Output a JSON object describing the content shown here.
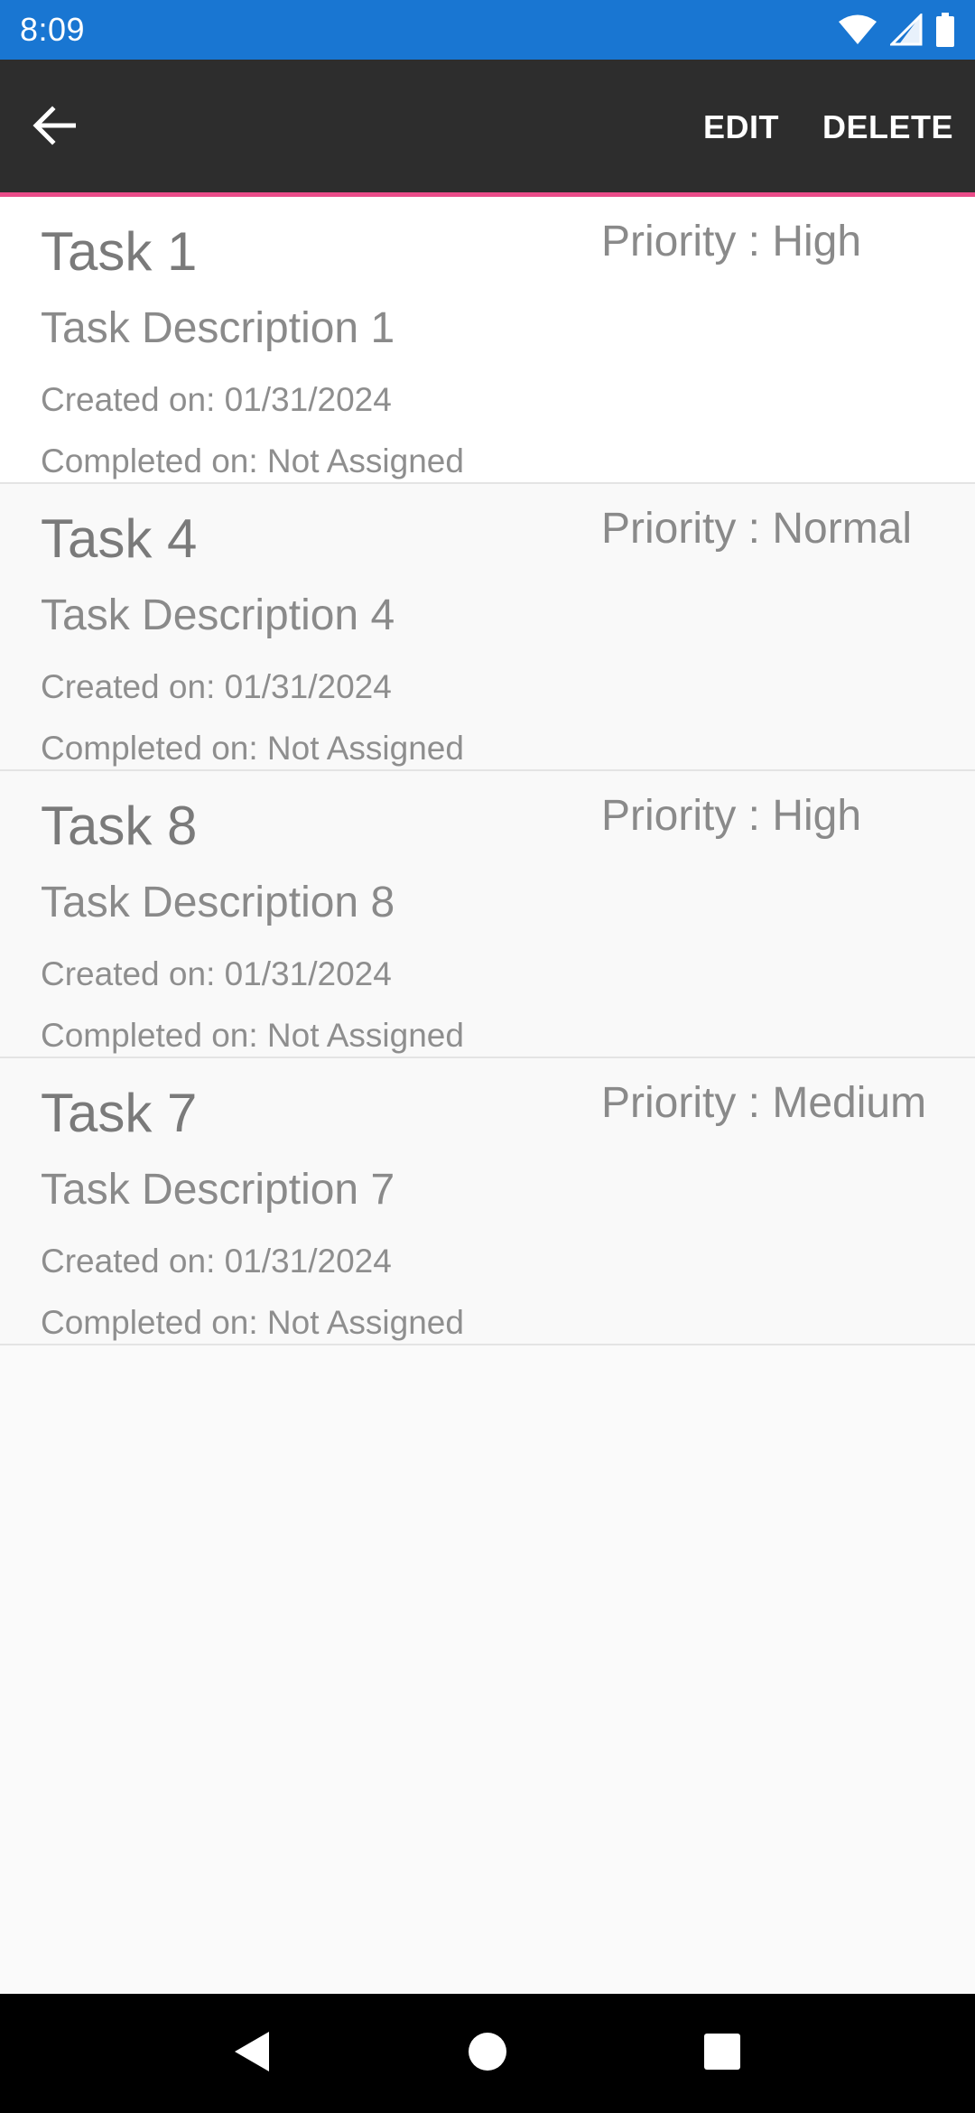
{
  "status_bar": {
    "time": "8:09",
    "icons": [
      "wifi-icon",
      "signal-icon",
      "battery-icon"
    ],
    "color": "#1976d2"
  },
  "app_bar": {
    "back_icon": "arrow-back-icon",
    "edit_label": "EDIT",
    "delete_label": "DELETE",
    "accent_color": "#ea4c89"
  },
  "tasks": [
    {
      "title": "Task 1",
      "priority": "Priority : High",
      "description": "Task Description 1",
      "created": "Created on: 01/31/2024",
      "completed": "Completed on: Not Assigned"
    },
    {
      "title": "Task 4",
      "priority": "Priority : Normal",
      "description": "Task Description 4",
      "created": "Created on: 01/31/2024",
      "completed": "Completed on: Not Assigned"
    },
    {
      "title": "Task 8",
      "priority": "Priority : High",
      "description": "Task Description 8",
      "created": "Created on: 01/31/2024",
      "completed": "Completed on: Not Assigned"
    },
    {
      "title": "Task 7",
      "priority": "Priority : Medium",
      "description": "Task Description 7",
      "created": "Created on: 01/31/2024",
      "completed": "Completed on: Not Assigned"
    }
  ],
  "nav_bar": {
    "icons": [
      "nav-back-icon",
      "nav-home-icon",
      "nav-recents-icon"
    ]
  }
}
